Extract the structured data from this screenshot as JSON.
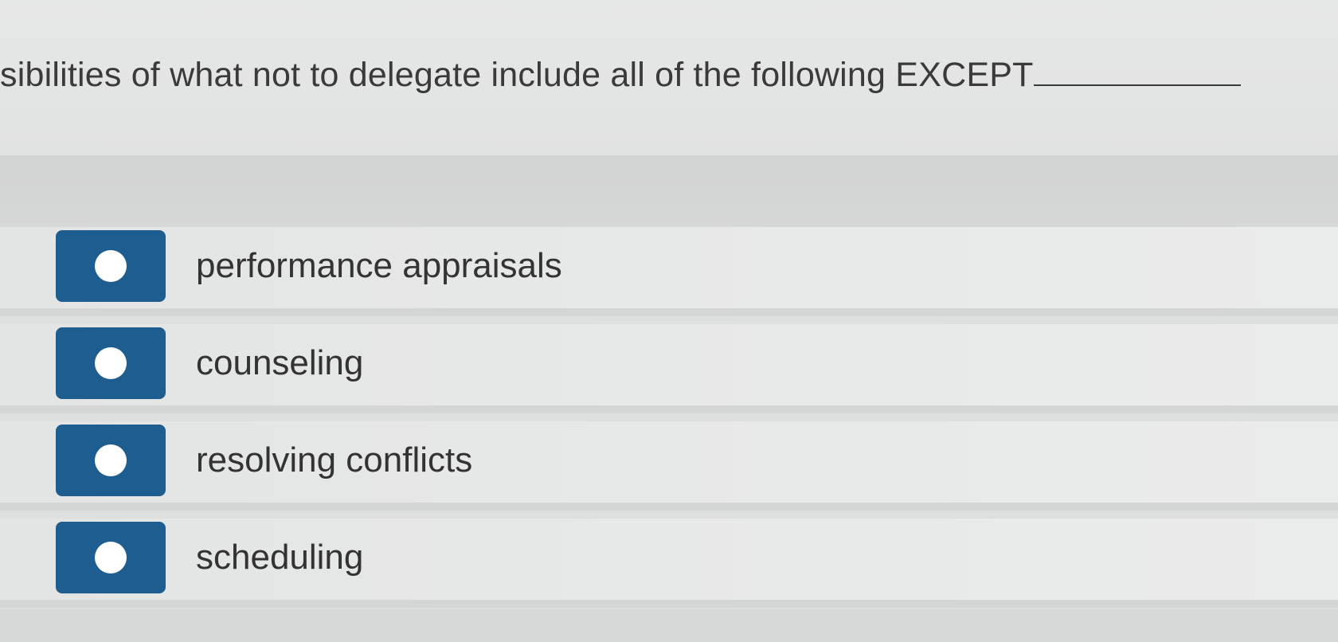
{
  "question": {
    "text": "sibilities of what not to delegate include all of the following EXCEPT"
  },
  "options": [
    {
      "label": "performance appraisals"
    },
    {
      "label": "counseling"
    },
    {
      "label": "resolving conflicts"
    },
    {
      "label": "scheduling"
    }
  ],
  "colors": {
    "radio_fill": "#1d5d8f",
    "radio_dot": "#ffffff",
    "text": "#333333"
  }
}
